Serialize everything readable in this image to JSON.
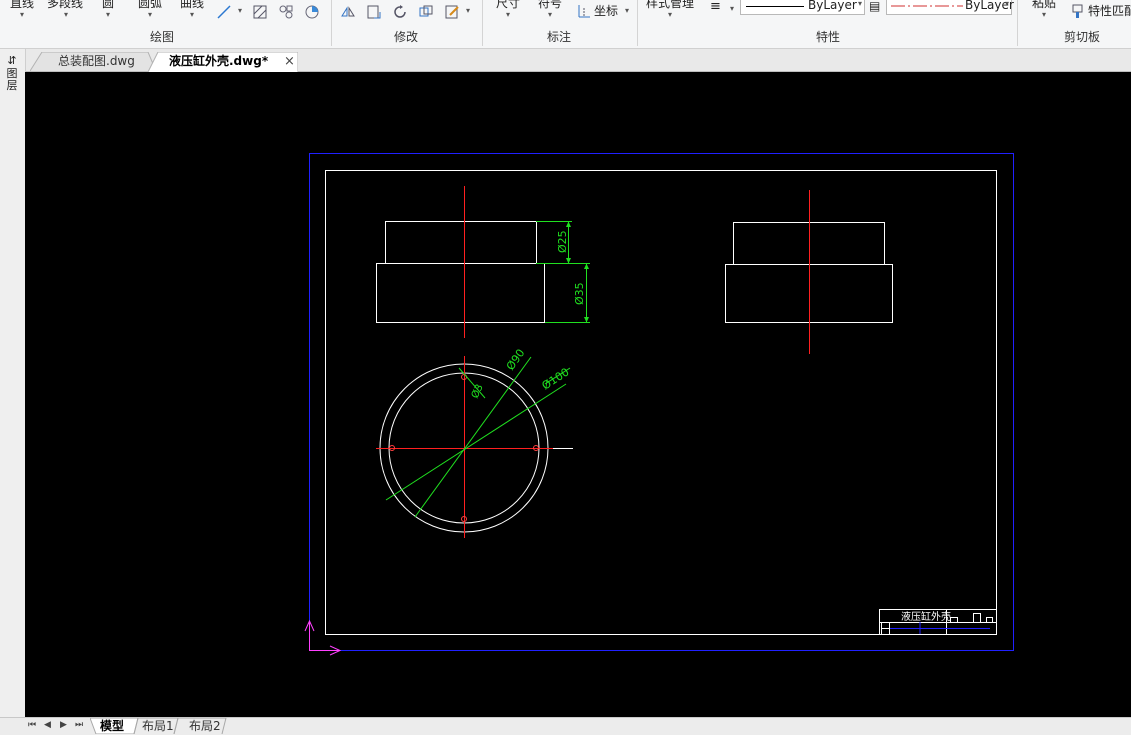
{
  "ribbon": {
    "draw_tools": [
      "直线",
      "多段线",
      "圆",
      "圆弧",
      "曲线"
    ],
    "dim_tools": [
      "尺寸",
      "符号",
      "坐标"
    ],
    "style_manage": "样式管理",
    "paste": "粘贴",
    "match_props": "特性匹配",
    "linetype_value": "ByLayer",
    "lineweight_value": "ByLayer",
    "groups": [
      "绘图",
      "修改",
      "标注",
      "特性",
      "剪切板"
    ]
  },
  "tabs": [
    {
      "label": "总装配图.dwg"
    },
    {
      "label": "液压缸外壳.dwg*"
    }
  ],
  "tab_close": "×",
  "sidebar": {
    "label": "图层"
  },
  "drawing": {
    "dims": {
      "d25": "Ø25",
      "d35": "Ø35",
      "d90": "Ø90",
      "d100": "Ø100",
      "d3": "Ø3"
    },
    "title_block_text": "液压缸外壳"
  },
  "bottom_tabs": [
    "模型",
    "布局1",
    "布局2"
  ],
  "nav_glyphs": [
    "⏮",
    "◀",
    "▶",
    "⏭"
  ],
  "colors": {
    "canvas_bg": "#000000",
    "geometry": "#ffffff",
    "centerline": "#ff2020",
    "dimension": "#20e020",
    "sheet_border": "#2020ff",
    "ucs": "#ff40ff",
    "linetype_red": "#d03030"
  }
}
